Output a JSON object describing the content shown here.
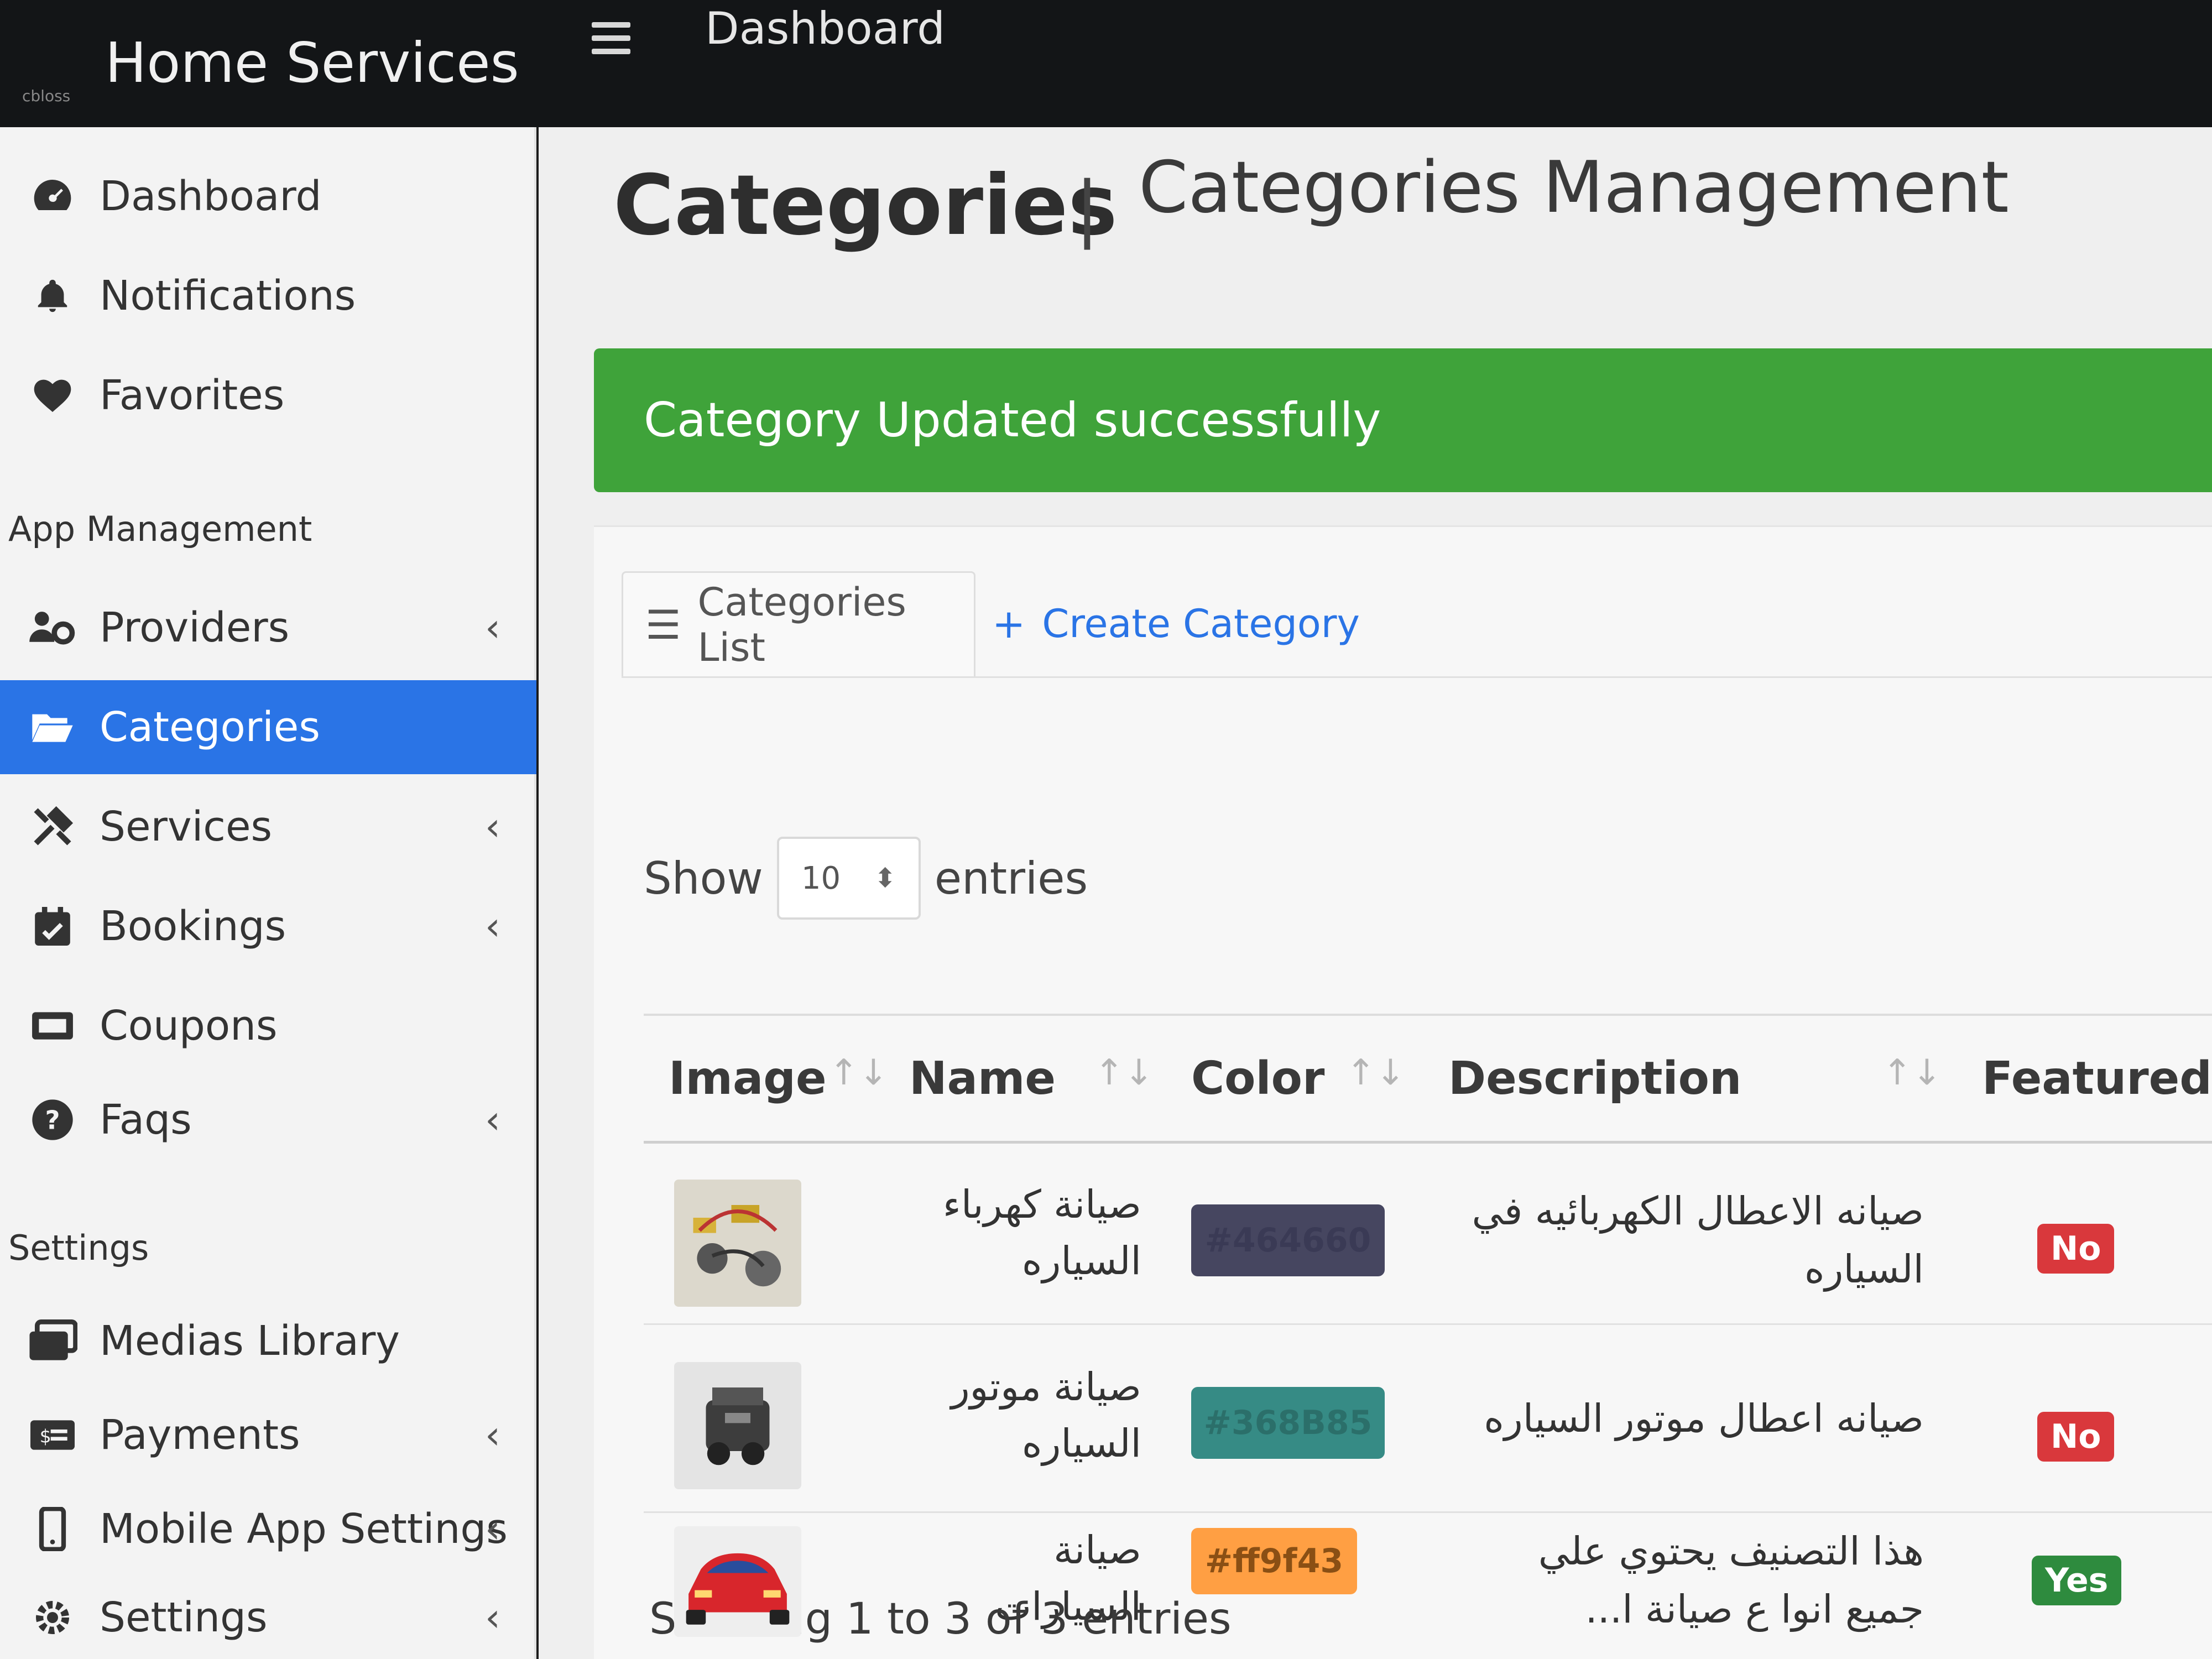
{
  "header": {
    "brand_logo_text": "cbloss",
    "brand": "Home Services",
    "page": "Dashboard"
  },
  "sidebar": {
    "items_top": [
      {
        "label": "Dashboard",
        "icon": "dashboard-gauge-icon"
      },
      {
        "label": "Notifications",
        "icon": "bell-icon"
      },
      {
        "label": "Favorites",
        "icon": "heart-icon"
      }
    ],
    "section_app": "App Management",
    "items_app": [
      {
        "label": "Providers",
        "icon": "users-cog-icon",
        "has_children": true
      },
      {
        "label": "Categories",
        "icon": "folder-open-icon",
        "active": true
      },
      {
        "label": "Services",
        "icon": "tools-icon",
        "has_children": true
      },
      {
        "label": "Bookings",
        "icon": "calendar-check-icon",
        "has_children": true
      },
      {
        "label": "Coupons",
        "icon": "ticket-icon"
      },
      {
        "label": "Faqs",
        "icon": "question-circle-icon",
        "has_children": true
      }
    ],
    "section_settings": "Settings",
    "items_settings": [
      {
        "label": "Medias Library",
        "icon": "images-icon"
      },
      {
        "label": "Payments",
        "icon": "money-bill-icon",
        "has_children": true
      },
      {
        "label": "Mobile App Settings",
        "icon": "mobile-icon",
        "has_children": true
      },
      {
        "label": "Settings",
        "icon": "cogs-icon",
        "has_children": true
      }
    ]
  },
  "main": {
    "title": "Categories",
    "separator": "|",
    "subtitle": "Categories Management",
    "alert": "Category Updated successfully",
    "tabs": [
      {
        "label": "Categories List",
        "icon": "list-icon"
      },
      {
        "label": "Create Category",
        "icon": "plus-icon"
      }
    ],
    "show_label": "Show",
    "page_size": "10",
    "entries_label": "entries",
    "columns": [
      "Image",
      "Name",
      "Color",
      "Description",
      "Featured"
    ],
    "rows": [
      {
        "name": "صيانة كهرباء السياره",
        "color": "#464660",
        "color_text": "#464660",
        "description": "صيانه الاعطال الكهربائيه في السياره",
        "featured": "No",
        "image": "electrical-parts-thumbnail"
      },
      {
        "name": "صيانة موتور السياره",
        "color": "#368B85",
        "color_text": "#368B85",
        "description": "صيانه اعطال موتور السياره",
        "featured": "No",
        "image": "engine-thumbnail"
      },
      {
        "name": "صيانة السيارات",
        "color": "#ff9f43",
        "color_text": "#ff9f43",
        "description": "هذا التصنيف يحتوي علي جميع انوا ع صيانة ا...",
        "featured": "Yes",
        "image": "red-car-thumbnail"
      }
    ],
    "info": "Showing 1 to 3 of 3 entries"
  }
}
